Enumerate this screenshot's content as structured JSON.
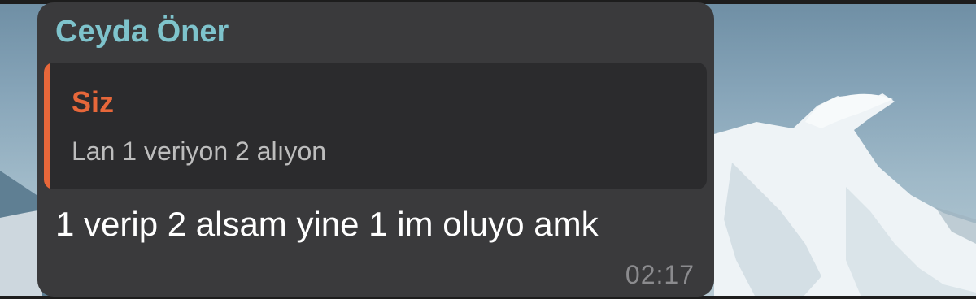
{
  "message": {
    "sender_name": "Ceyda Öner",
    "reply": {
      "author": "Siz",
      "text": "Lan 1 veriyon 2 alıyon"
    },
    "text": "1 verip 2 alsam yine 1 im oluyo amk",
    "time": "02:17"
  },
  "colors": {
    "sender_name": "#7ec3cc",
    "reply_accent": "#e7673a",
    "bubble_background": "#3a3a3c",
    "reply_background": "#2b2b2d",
    "message_text": "#ffffff",
    "time_text": "#8b8b8e"
  }
}
